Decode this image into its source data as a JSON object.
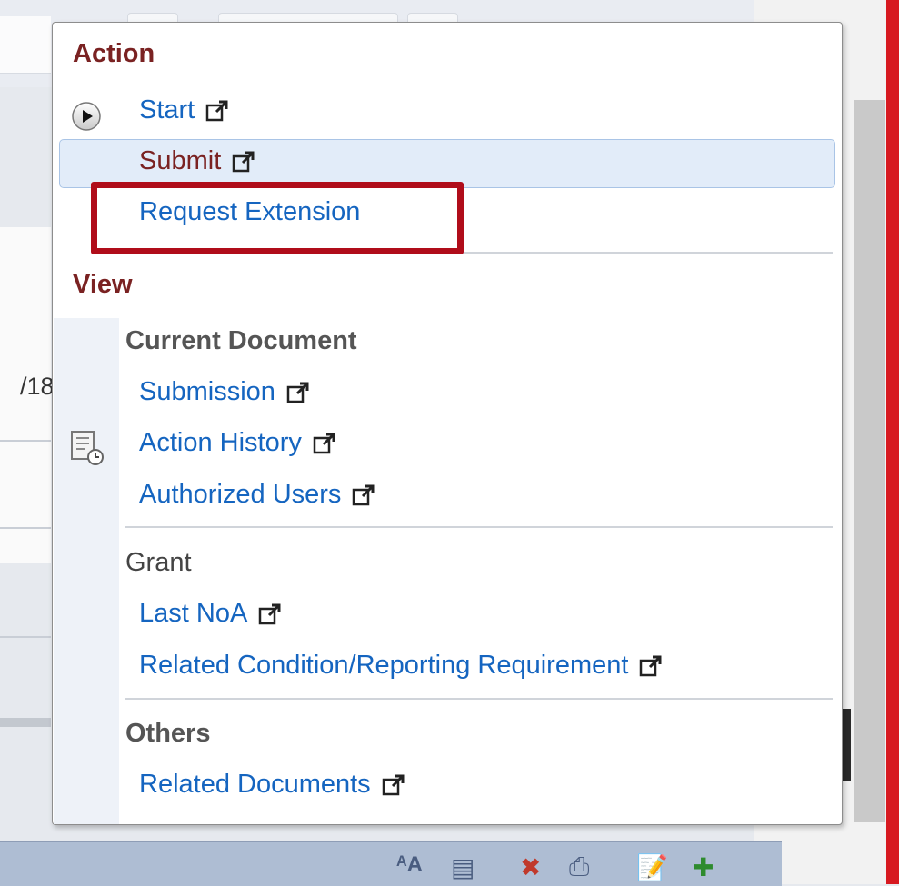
{
  "background": {
    "partial_text": "/18"
  },
  "menu": {
    "action": {
      "heading": "Action",
      "items": [
        {
          "label": "Start",
          "external": true
        },
        {
          "label": "Submit",
          "external": true,
          "highlighted": true
        },
        {
          "label": "Request Extension",
          "external": false,
          "annotated": true
        }
      ]
    },
    "view": {
      "heading": "View",
      "groups": [
        {
          "heading": "Current Document",
          "items": [
            {
              "label": "Submission",
              "external": true
            },
            {
              "label": "Action History",
              "external": true
            },
            {
              "label": "Authorized Users",
              "external": true
            }
          ]
        },
        {
          "heading": "Grant",
          "items": [
            {
              "label": "Last NoA",
              "external": true
            },
            {
              "label": "Related Condition/Reporting Requirement",
              "external": true
            }
          ]
        },
        {
          "heading": "Others",
          "items": [
            {
              "label": "Related Documents",
              "external": true
            }
          ]
        }
      ]
    }
  },
  "colors": {
    "section_heading": "#7a2222",
    "link": "#1565c0",
    "highlight_bg": "#e2ecf9",
    "annotation_box": "#b00d1a"
  },
  "icons": [
    "play-icon",
    "external-link-icon",
    "document-history-icon"
  ]
}
